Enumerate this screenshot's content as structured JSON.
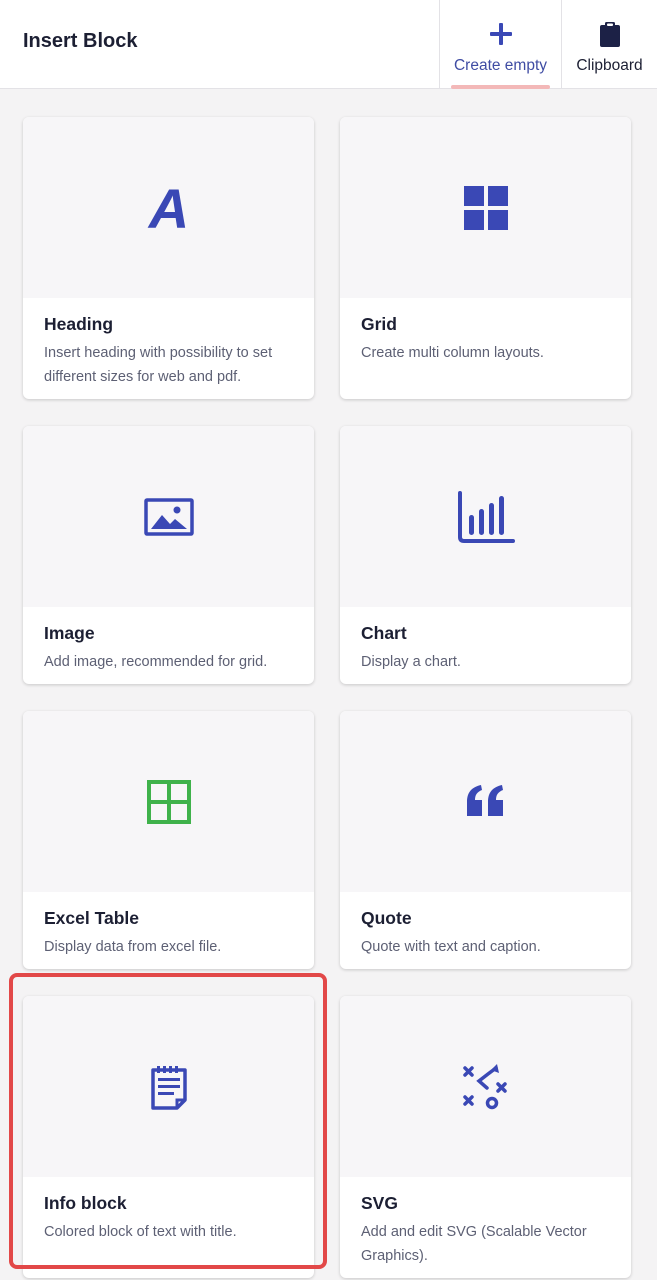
{
  "header": {
    "title": "Insert Block",
    "tabs": [
      {
        "label": "Create empty",
        "icon": "plus-icon",
        "selected": true
      },
      {
        "label": "Clipboard",
        "icon": "clipboard-icon",
        "selected": false
      }
    ]
  },
  "colors": {
    "accent": "#3f4ca3",
    "icon_blue": "#3a48b5",
    "excel_green": "#3fb24b",
    "highlight_red": "#e24848"
  },
  "blocks": [
    {
      "title": "Heading",
      "description": "Insert heading with possibility to set different sizes for web and pdf.",
      "icon": "heading-letter-a-icon"
    },
    {
      "title": "Grid",
      "description": "Create multi column layouts.",
      "icon": "grid-icon"
    },
    {
      "title": "Image",
      "description": "Add image, recommended for grid.",
      "icon": "image-icon"
    },
    {
      "title": "Chart",
      "description": "Display a chart.",
      "icon": "bar-chart-icon"
    },
    {
      "title": "Excel Table",
      "description": "Display data from excel file.",
      "icon": "table-icon"
    },
    {
      "title": "Quote",
      "description": "Quote with text and caption.",
      "icon": "quote-icon"
    },
    {
      "title": "Info block",
      "description": "Colored block of text with title.",
      "icon": "notepad-icon",
      "highlighted": true
    },
    {
      "title": "SVG",
      "description": "Add and edit SVG (Scalable Vector Graphics).",
      "icon": "strategy-icon"
    }
  ]
}
